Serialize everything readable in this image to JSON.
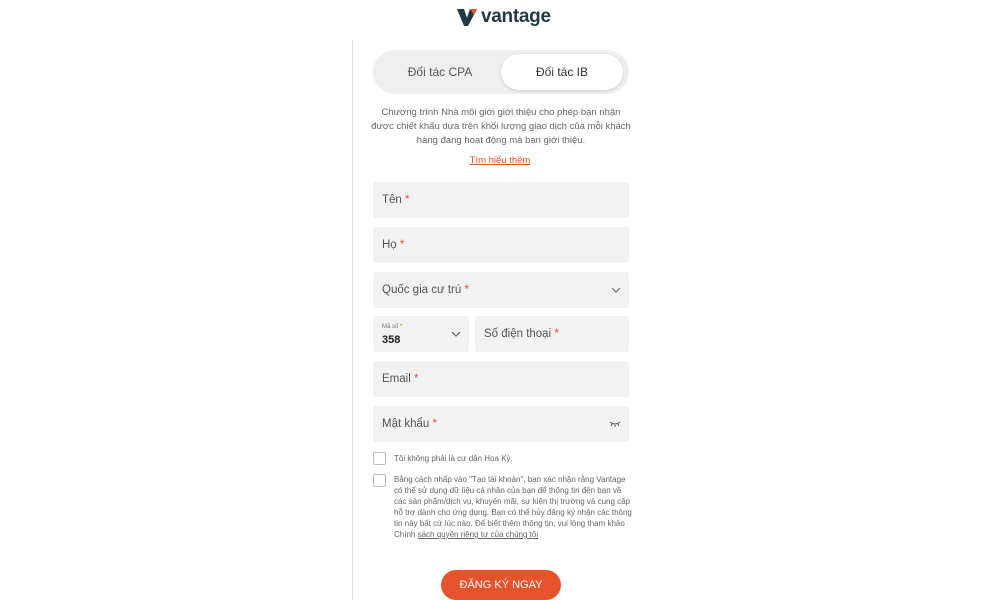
{
  "brand": {
    "name": "vantage",
    "accent": "#e5532c",
    "dark": "#1f3a44"
  },
  "tabs": [
    {
      "label": "Đối tác CPA",
      "active": false
    },
    {
      "label": "Đối tác IB",
      "active": true
    }
  ],
  "intro": {
    "text": "Chương trình Nhà môi giới giới thiệu cho phép bạn nhận được chiết khấu dựa trên khối lượng giao dịch của mỗi khách hàng đang hoạt động mà bạn giới thiệu.",
    "link": "Tìm hiểu thêm"
  },
  "form": {
    "required_mark": "*",
    "first_name": "Tên",
    "last_name": "Họ",
    "country": {
      "label": "Quốc gia cư trú",
      "icon": "chevron-down-icon"
    },
    "code": {
      "label": "Mã số",
      "value": "358",
      "icon": "chevron-down-icon"
    },
    "phone": "Số điện thoại",
    "email": "Email",
    "password": {
      "label": "Mật khẩu",
      "icon": "eye-closed-icon"
    }
  },
  "consent": {
    "us_resident": "Tôi không phải là cư dân Hoa Kỳ.",
    "marketing": "Bằng cách nhấp vào \"Tạo tài khoản\", bạn xác nhận rằng Vantage có thể sử dụng dữ liệu cá nhân của bạn để thông tin đến bạn về các sản phẩm/dịch vụ, khuyến mãi, sự kiện thị trường và cung cấp hỗ trợ dành cho ứng dụng. Bạn có thể hủy đăng ký nhận các thông tin này bất cứ lúc nào. Để biết thêm thông tin, vui lòng tham khảo Chính ",
    "privacy_link": "sách quyền riêng tư của chúng tôi"
  },
  "submit_label": "ĐĂNG KÝ NGAY"
}
